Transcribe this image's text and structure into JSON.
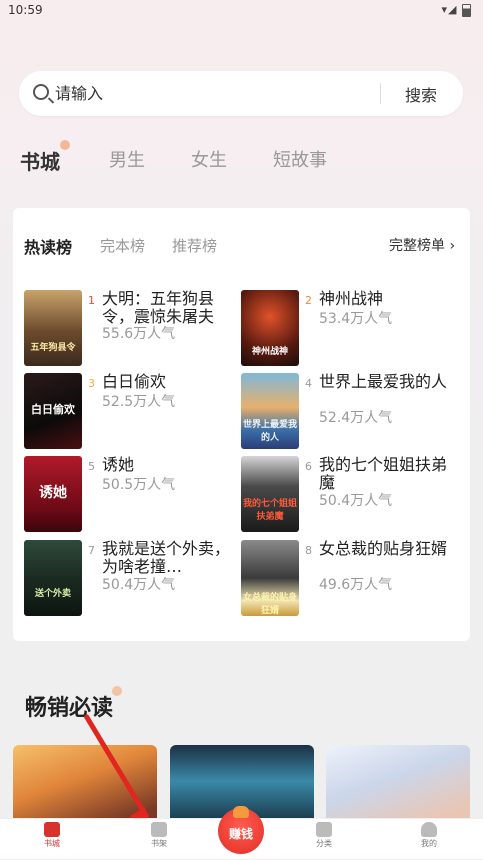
{
  "status_bar": {
    "time": "10:59",
    "icons": "▾◢"
  },
  "search": {
    "placeholder": "请输入",
    "button_label": "搜索"
  },
  "top_tabs": [
    {
      "label": "书城",
      "active": true
    },
    {
      "label": "男生"
    },
    {
      "label": "女生"
    },
    {
      "label": "短故事"
    }
  ],
  "rank": {
    "tabs": [
      {
        "label": "热读榜",
        "active": true
      },
      {
        "label": "完本榜"
      },
      {
        "label": "推荐榜"
      }
    ],
    "full_list_label": "完整榜单",
    "books": [
      {
        "rank": "1",
        "title": "大明：五年狗县令，震惊朱屠夫",
        "popularity": "55.6万人气",
        "cover_text": "五年狗县令"
      },
      {
        "rank": "2",
        "title": "神州战神",
        "popularity": "53.4万人气",
        "cover_text": "神州战神"
      },
      {
        "rank": "3",
        "title": "白日偷欢",
        "popularity": "52.5万人气",
        "cover_text": "白日偷欢"
      },
      {
        "rank": "4",
        "title": "世界上最爱我的人",
        "popularity": "52.4万人气",
        "cover_text": "世界上最爱我的人"
      },
      {
        "rank": "5",
        "title": "诱她",
        "popularity": "50.5万人气",
        "cover_text": "诱她"
      },
      {
        "rank": "6",
        "title": "我的七个姐姐扶弟魔",
        "popularity": "50.4万人气",
        "cover_text": "我的七个姐姐扶弟魔"
      },
      {
        "rank": "7",
        "title": "我就是送个外卖，为啥老撞…",
        "popularity": "50.4万人气",
        "cover_text": "送个外卖"
      },
      {
        "rank": "8",
        "title": "女总裁的贴身狂婿",
        "popularity": "49.6万人气",
        "cover_text": "女总裁的贴身狂婿"
      }
    ]
  },
  "bestseller": {
    "title": "畅销必读"
  },
  "bottom_nav": {
    "items": [
      {
        "label": "书城",
        "active": true
      },
      {
        "label": "书架"
      },
      {
        "label": "赚钱"
      },
      {
        "label": "分类"
      },
      {
        "label": "我的"
      }
    ]
  },
  "colors": {
    "accent": "#d7322c",
    "rank1": "#e9483f",
    "rank2": "#f08a3b",
    "rank3": "#f0b23b"
  }
}
